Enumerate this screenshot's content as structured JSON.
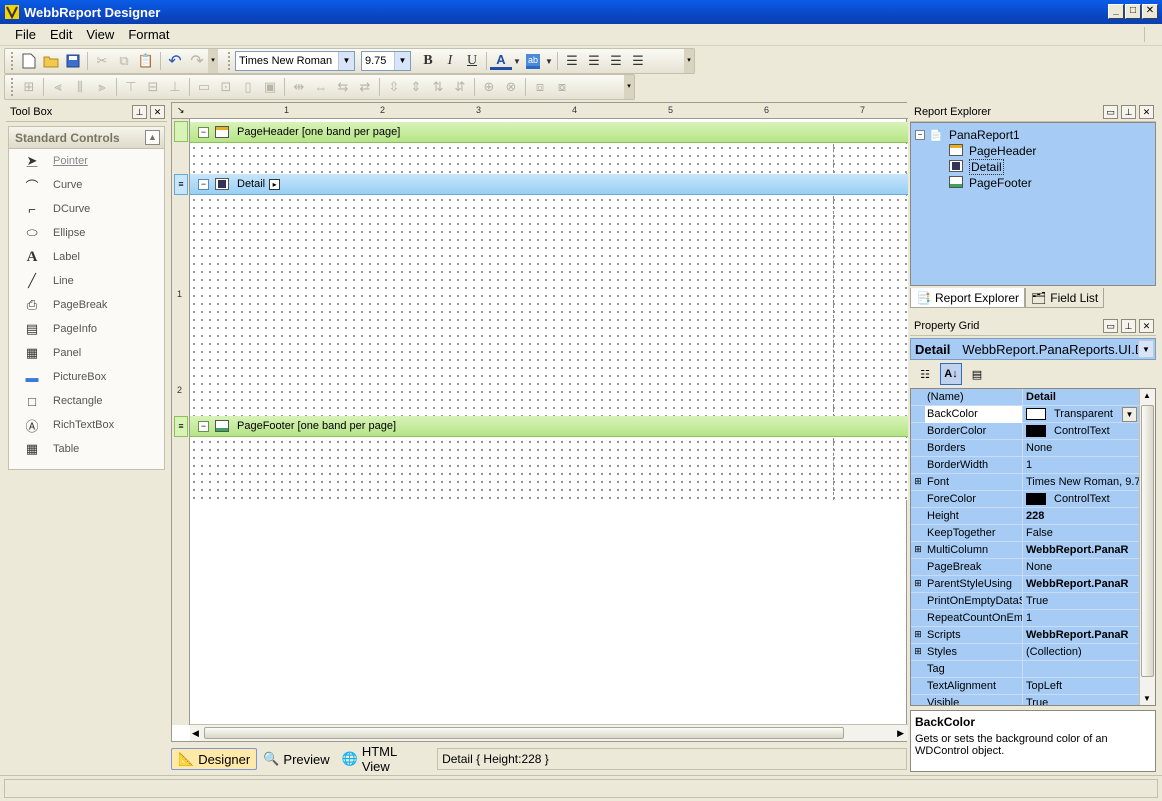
{
  "window": {
    "title": "WebbReport Designer"
  },
  "menu": [
    "File",
    "Edit",
    "View",
    "Format"
  ],
  "format_toolbar": {
    "font": "Times New Roman",
    "size": "9.75"
  },
  "toolbox": {
    "title": "Tool Box",
    "group": "Standard Controls",
    "items": [
      {
        "label": "Pointer",
        "icon": "pointer-icon"
      },
      {
        "label": "Curve",
        "icon": "curve-icon"
      },
      {
        "label": "DCurve",
        "icon": "dcurve-icon"
      },
      {
        "label": "Ellipse",
        "icon": "ellipse-icon"
      },
      {
        "label": "Label",
        "icon": "label-icon"
      },
      {
        "label": "Line",
        "icon": "line-icon"
      },
      {
        "label": "PageBreak",
        "icon": "pagebreak-icon"
      },
      {
        "label": "PageInfo",
        "icon": "pageinfo-icon"
      },
      {
        "label": "Panel",
        "icon": "panel-icon"
      },
      {
        "label": "PictureBox",
        "icon": "picturebox-icon"
      },
      {
        "label": "Rectangle",
        "icon": "rectangle-icon"
      },
      {
        "label": "RichTextBox",
        "icon": "richtextbox-icon"
      },
      {
        "label": "Table",
        "icon": "table-icon"
      }
    ]
  },
  "designer": {
    "ruler_top": [
      "1",
      "2",
      "3",
      "4",
      "5",
      "6",
      "7"
    ],
    "ruler_left": [
      "1",
      "2"
    ],
    "bands": {
      "header": "PageHeader [one band per page]",
      "detail": "Detail",
      "footer": "PageFooter [one band per page]"
    }
  },
  "view_tabs": [
    "Designer",
    "Preview",
    "HTML View"
  ],
  "status_cell": "Detail { Height:228 }",
  "report_explorer": {
    "title": "Report Explorer",
    "root": "PanaReport1",
    "children": [
      "PageHeader",
      "Detail",
      "PageFooter"
    ],
    "tabs": [
      "Report Explorer",
      "Field List"
    ]
  },
  "property_grid": {
    "title": "Property Grid",
    "selected_object": "Detail",
    "selected_type": "WebbReport.PanaReports.UI.D",
    "rows": [
      {
        "name": "(Name)",
        "value": "Detail",
        "bold": true,
        "expand": false
      },
      {
        "name": "BackColor",
        "value": "Transparent",
        "swatch": "#ffffff",
        "expand": false
      },
      {
        "name": "BorderColor",
        "value": "ControlText",
        "swatch": "#000000",
        "expand": false
      },
      {
        "name": "Borders",
        "value": "None",
        "expand": false
      },
      {
        "name": "BorderWidth",
        "value": "1",
        "expand": false
      },
      {
        "name": "Font",
        "value": "Times New Roman, 9.7",
        "expand": true
      },
      {
        "name": "ForeColor",
        "value": "ControlText",
        "swatch": "#000000",
        "expand": false
      },
      {
        "name": "Height",
        "value": "228",
        "bold": true,
        "expand": false
      },
      {
        "name": "KeepTogether",
        "value": "False",
        "expand": false
      },
      {
        "name": "MultiColumn",
        "value": "WebbReport.PanaR",
        "bold": true,
        "expand": true
      },
      {
        "name": "PageBreak",
        "value": "None",
        "expand": false
      },
      {
        "name": "ParentStyleUsing",
        "value": "WebbReport.PanaR",
        "bold": true,
        "expand": true
      },
      {
        "name": "PrintOnEmptyDataS",
        "value": "True",
        "expand": false
      },
      {
        "name": "RepeatCountOnEmp",
        "value": "1",
        "expand": false
      },
      {
        "name": "Scripts",
        "value": "WebbReport.PanaR",
        "bold": true,
        "expand": true
      },
      {
        "name": "Styles",
        "value": "(Collection)",
        "expand": true
      },
      {
        "name": "Tag",
        "value": "",
        "expand": false
      },
      {
        "name": "TextAlignment",
        "value": "TopLeft",
        "expand": false
      },
      {
        "name": "Visible",
        "value": "True",
        "expand": false
      }
    ],
    "help_title": "BackColor",
    "help_text": "Gets or sets the background color of an WDControl object."
  }
}
